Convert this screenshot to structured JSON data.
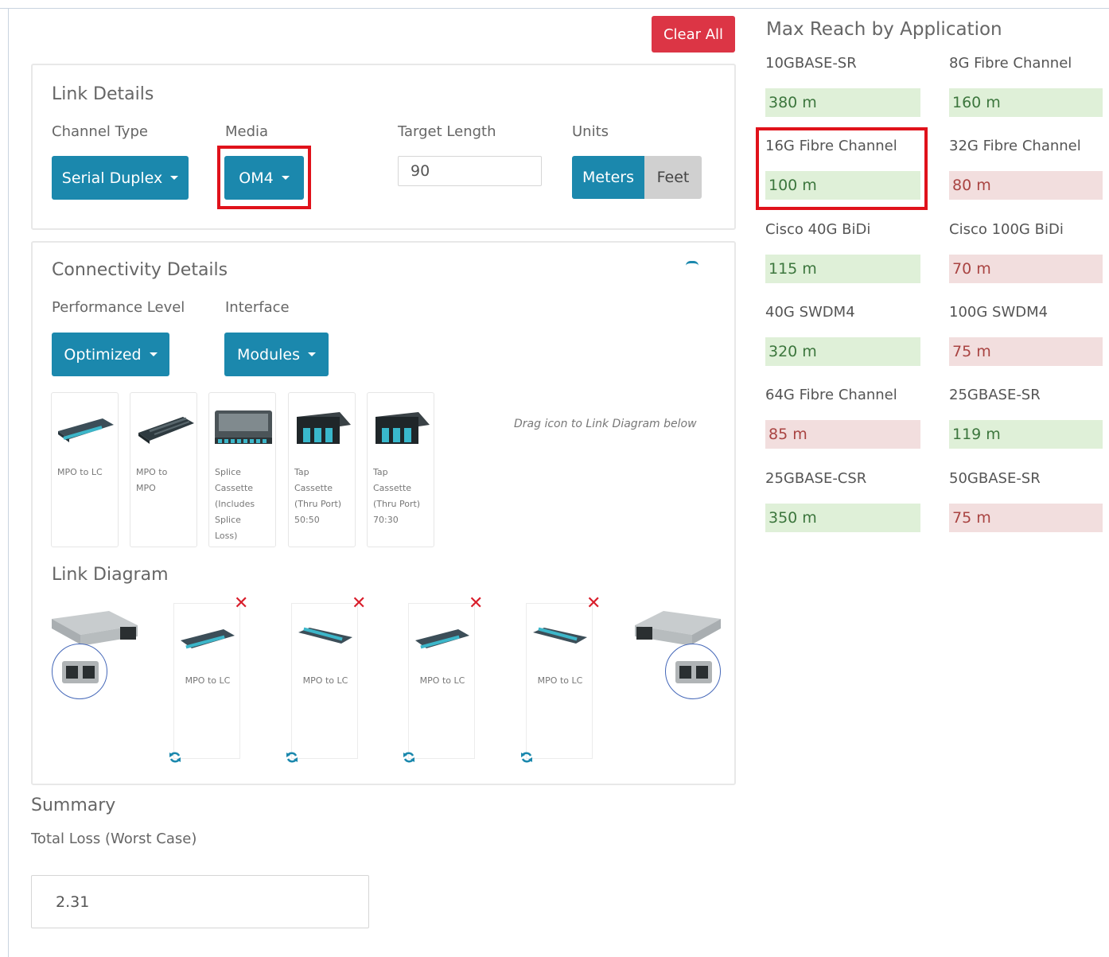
{
  "toolbar": {
    "clear_all_label": "Clear All"
  },
  "link_details": {
    "title": "Link Details",
    "channel_type_label": "Channel Type",
    "channel_type_value": "Serial Duplex",
    "media_label": "Media",
    "media_value": "OM4",
    "target_length_label": "Target Length",
    "target_length_value": "90",
    "units_label": "Units",
    "units_options": [
      "Meters",
      "Feet"
    ],
    "units_selected": "Meters"
  },
  "connectivity": {
    "title": "Connectivity Details",
    "performance_label": "Performance Level",
    "performance_value": "Optimized",
    "interface_label": "Interface",
    "interface_value": "Modules",
    "drag_hint": "Drag icon to Link Diagram below",
    "modules": [
      {
        "lines": [
          "MPO to LC"
        ]
      },
      {
        "lines": [
          "MPO to",
          "MPO"
        ]
      },
      {
        "lines": [
          "Splice",
          "Cassette",
          "(Includes",
          "Splice",
          "Loss)"
        ]
      },
      {
        "lines": [
          "Tap",
          "Cassette",
          "(Thru Port)",
          "50:50"
        ]
      },
      {
        "lines": [
          "Tap",
          "Cassette",
          "(Thru Port)",
          "70:30"
        ]
      }
    ]
  },
  "link_diagram": {
    "title": "Link Diagram",
    "items": [
      "MPO to LC",
      "MPO to LC",
      "MPO to LC",
      "MPO to LC"
    ]
  },
  "summary": {
    "title": "Summary",
    "total_loss_label": "Total Loss (Worst Case)",
    "total_loss_value": "2.31"
  },
  "max_reach": {
    "title": "Max Reach by Application",
    "apps": [
      {
        "name": "10GBASE-SR",
        "value": "380 m",
        "status": "ok"
      },
      {
        "name": "8G Fibre Channel",
        "value": "160 m",
        "status": "ok"
      },
      {
        "name": "16G Fibre Channel",
        "value": "100 m",
        "status": "ok"
      },
      {
        "name": "32G Fibre Channel",
        "value": "80 m",
        "status": "fail"
      },
      {
        "name": "Cisco 40G BiDi",
        "value": "115 m",
        "status": "ok"
      },
      {
        "name": "Cisco 100G BiDi",
        "value": "70 m",
        "status": "fail"
      },
      {
        "name": "40G SWDM4",
        "value": "320 m",
        "status": "ok"
      },
      {
        "name": "100G SWDM4",
        "value": "75 m",
        "status": "fail"
      },
      {
        "name": "64G Fibre Channel",
        "value": "85 m",
        "status": "fail"
      },
      {
        "name": "25GBASE-SR",
        "value": "119 m",
        "status": "ok"
      },
      {
        "name": "25GBASE-CSR",
        "value": "350 m",
        "status": "ok"
      },
      {
        "name": "50GBASE-SR",
        "value": "75 m",
        "status": "fail"
      }
    ]
  },
  "colors": {
    "accent": "#1b88ad",
    "danger": "#dc3545",
    "highlight": "#e0121b",
    "ok_bg": "#dff0d8",
    "fail_bg": "#f2dede"
  },
  "icons": [
    "caret-down-icon",
    "delete-x-icon",
    "refresh-icon",
    "cassette-icon",
    "transceiver-icon",
    "lc-port-icon"
  ]
}
